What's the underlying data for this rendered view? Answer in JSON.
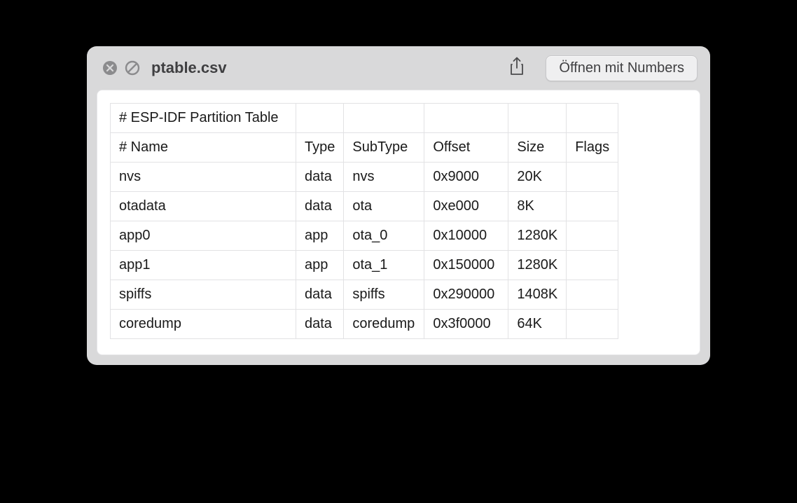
{
  "titlebar": {
    "filename": "ptable.csv",
    "open_button_label": "Öffnen mit Numbers"
  },
  "table": {
    "rows": [
      {
        "c0": "# ESP-IDF Partition Table",
        "c1": "",
        "c2": "",
        "c3": "",
        "c4": "",
        "c5": ""
      },
      {
        "c0": "# Name",
        "c1": "Type",
        "c2": "SubType",
        "c3": "Offset",
        "c4": "Size",
        "c5": "Flags"
      },
      {
        "c0": "nvs",
        "c1": "data",
        "c2": "nvs",
        "c3": "0x9000",
        "c4": "20K",
        "c5": ""
      },
      {
        "c0": "otadata",
        "c1": "data",
        "c2": "ota",
        "c3": "0xe000",
        "c4": "8K",
        "c5": ""
      },
      {
        "c0": "app0",
        "c1": "app",
        "c2": "ota_0",
        "c3": "0x10000",
        "c4": "1280K",
        "c5": ""
      },
      {
        "c0": "app1",
        "c1": "app",
        "c2": "ota_1",
        "c3": "0x150000",
        "c4": "1280K",
        "c5": ""
      },
      {
        "c0": "spiffs",
        "c1": "data",
        "c2": "spiffs",
        "c3": "0x290000",
        "c4": "1408K",
        "c5": ""
      },
      {
        "c0": "coredump",
        "c1": "data",
        "c2": "coredump",
        "c3": "0x3f0000",
        "c4": "64K",
        "c5": ""
      }
    ]
  }
}
